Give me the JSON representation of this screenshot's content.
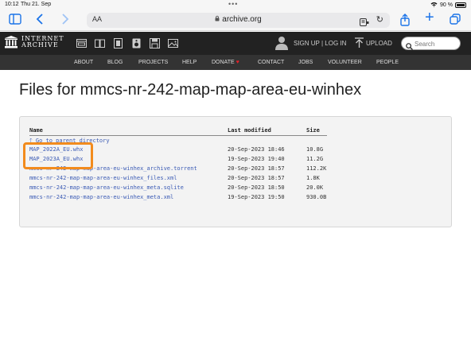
{
  "status_bar": {
    "time": "10:12",
    "date": "Thu 21. Sep",
    "battery": "90 %"
  },
  "browser": {
    "text_size_label": "AA",
    "url": "archive.org",
    "accent_color": "#1a73e8"
  },
  "ia_header": {
    "logo_line1": "INTERNET",
    "logo_line2": "ARCHIVE",
    "signup_login": "SIGN UP | LOG IN",
    "upload": "UPLOAD",
    "search_placeholder": "Search",
    "media_icons": [
      "web-icon",
      "texts-icon",
      "video-icon",
      "audio-icon",
      "software-icon",
      "images-icon"
    ]
  },
  "ia_nav": {
    "items": [
      "ABOUT",
      "BLOG",
      "PROJECTS",
      "HELP",
      "DONATE",
      "CONTACT",
      "JOBS",
      "VOLUNTEER",
      "PEOPLE"
    ]
  },
  "page": {
    "title": "Files for mmcs-nr-242-map-map-area-eu-winhex"
  },
  "file_listing": {
    "headers": {
      "name": "Name",
      "modified": "Last modified",
      "size": "Size"
    },
    "parent_link": "Go to parent directory",
    "files": [
      {
        "name": "MAP_2022A_EU.whx",
        "modified": "20-Sep-2023 18:46",
        "size": "10.8G"
      },
      {
        "name": "MAP_2023A_EU.whx",
        "modified": "19-Sep-2023 19:40",
        "size": "11.2G"
      },
      {
        "name": "mmcs-nr-242-map-map-area-eu-winhex_archive.torrent",
        "modified": "20-Sep-2023 18:57",
        "size": "112.2K"
      },
      {
        "name": "mmcs-nr-242-map-map-area-eu-winhex_files.xml",
        "modified": "20-Sep-2023 18:57",
        "size": "1.8K"
      },
      {
        "name": "mmcs-nr-242-map-map-area-eu-winhex_meta.sqlite",
        "modified": "20-Sep-2023 18:50",
        "size": "20.0K"
      },
      {
        "name": "mmcs-nr-242-map-map-area-eu-winhex_meta.xml",
        "modified": "19-Sep-2023 19:50",
        "size": "930.0B"
      }
    ],
    "link_color": "#3b5bb5",
    "highlight_color": "#f28b1d"
  }
}
